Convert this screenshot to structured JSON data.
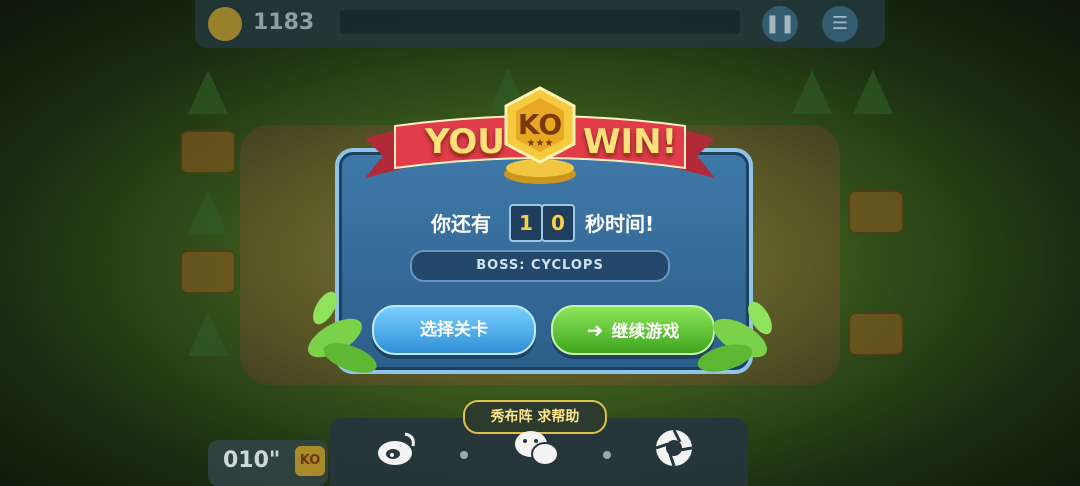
{
  "hud": {
    "coins": "1183"
  },
  "popup": {
    "ribbon_left": "YOU",
    "ribbon_ko": "KO",
    "ribbon_right": "WIN!",
    "timer_prefix": "你还有",
    "timer_digits": [
      "1",
      "0"
    ],
    "timer_suffix": "秒时间!",
    "boss_label": "BOSS: CYCLOPS",
    "select_level_label": "选择关卡",
    "continue_label": "继续游戏"
  },
  "share": {
    "label": "秀布阵 求帮助",
    "icons": [
      "weibo-icon",
      "wechat-icon",
      "camera-aperture-icon"
    ]
  },
  "footer": {
    "elapsed": "010\"",
    "ko": "KO"
  },
  "colors": {
    "ribbon": "#e03c4a",
    "panel": "#3f79a8",
    "select_button": "#2f8fd6",
    "continue_button": "#3ea61e",
    "digits": "#f7d048"
  }
}
